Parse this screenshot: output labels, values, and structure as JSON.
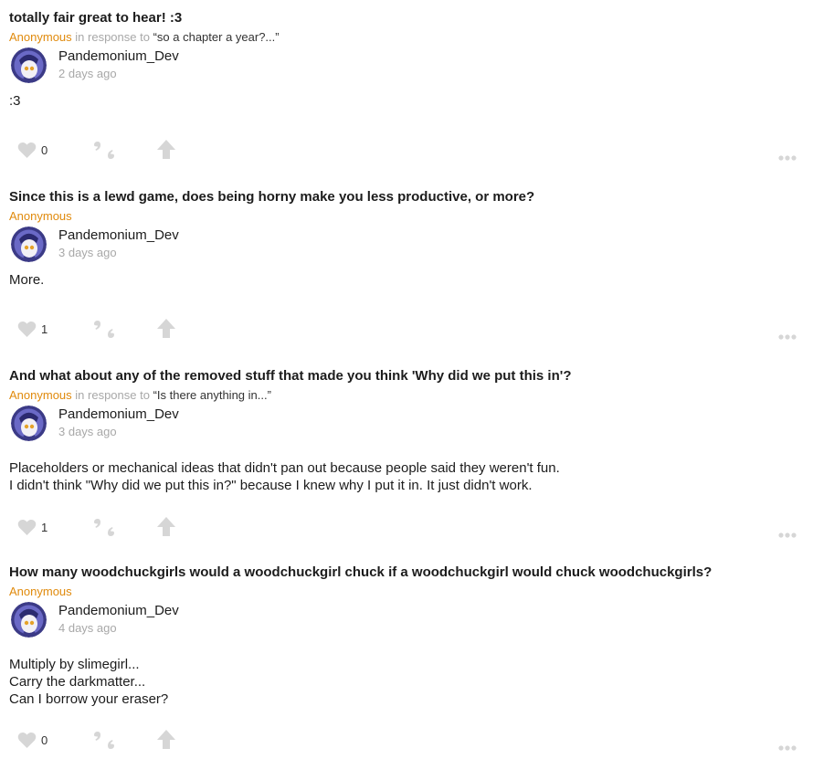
{
  "posts": [
    {
      "question": "totally fair great to hear! :3",
      "asker": "Anonymous",
      "in_response_to": "in response to",
      "quote": "“so a chapter a year?...”",
      "author": "Pandemonium_Dev",
      "time": "2 days ago",
      "answer_lines": [
        ":3"
      ],
      "likes": "0"
    },
    {
      "question": "Since this is a lewd game, does being horny make you less productive, or more?",
      "asker": "Anonymous",
      "in_response_to": "",
      "quote": "",
      "author": "Pandemonium_Dev",
      "time": "3 days ago",
      "answer_lines": [
        "More."
      ],
      "likes": "1"
    },
    {
      "question": "And what about any of the removed stuff that made you think 'Why did we put this in'?",
      "asker": "Anonymous",
      "in_response_to": "in response to",
      "quote": "“Is there anything in...”",
      "author": "Pandemonium_Dev",
      "time": "3 days ago",
      "answer_lines": [
        "Placeholders or mechanical ideas that didn't pan out because people said they weren't fun.",
        "I didn't think \"Why did we put this in?\" because I knew why I put it in. It just didn't work."
      ],
      "likes": "1"
    },
    {
      "question": "How many woodchuckgirls would a woodchuckgirl chuck if a woodchuckgirl would chuck woodchuckgirls?",
      "asker": "Anonymous",
      "in_response_to": "",
      "quote": "",
      "author": "Pandemonium_Dev",
      "time": "4 days ago",
      "answer_lines": [
        "Multiply by slimegirl...",
        "Carry the darkmatter...",
        "Can I borrow your eraser?"
      ],
      "likes": "0"
    }
  ],
  "icons": {
    "like": "heart-icon",
    "quote": "quote-icon",
    "share": "share-arrow-icon",
    "more": "more-dots-icon",
    "avatar": "avatar"
  },
  "colors": {
    "asker": "#e08a0c",
    "muted": "#a8a8a8",
    "icon": "#d6d6d6",
    "text": "#1c1c1c"
  }
}
